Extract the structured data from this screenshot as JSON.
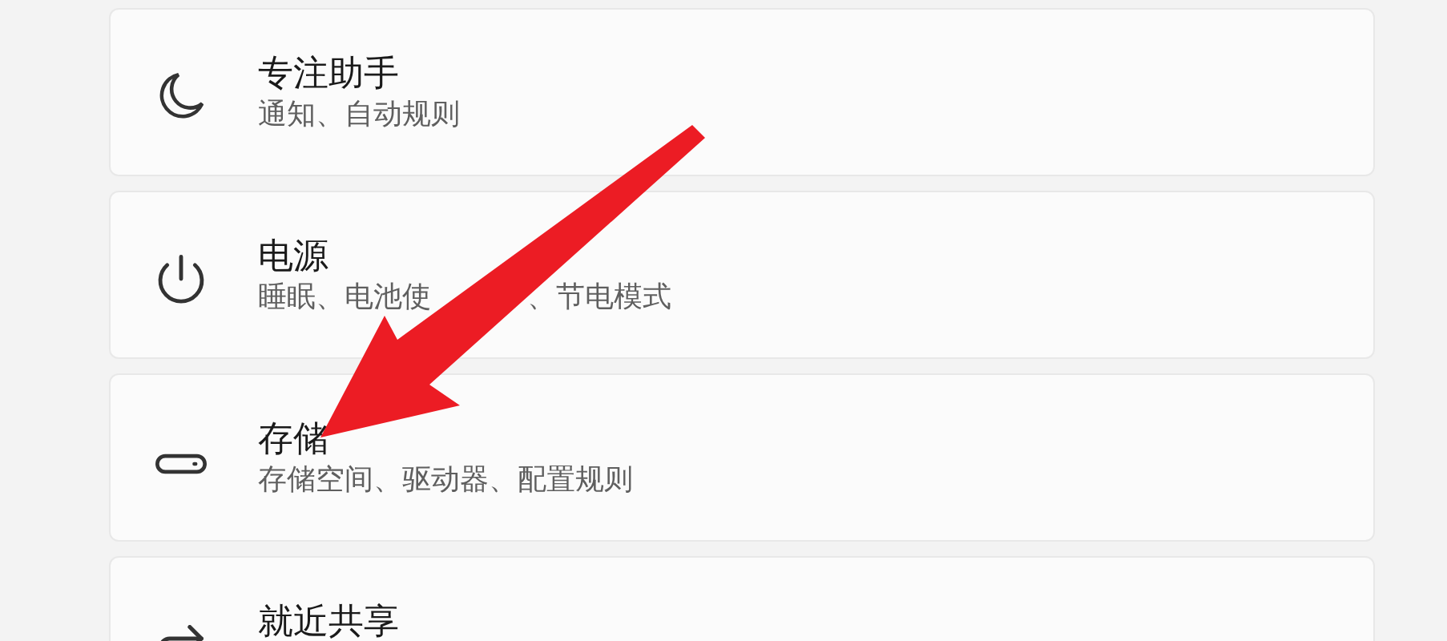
{
  "settings_items": [
    {
      "kind": "focus",
      "title": "专注助手",
      "subtitle": [
        "通知、自动规则"
      ]
    },
    {
      "kind": "power",
      "title": "电源",
      "subtitle": [
        "睡眠、电池使",
        "、节电模式"
      ]
    },
    {
      "kind": "storage",
      "title": "存储",
      "subtitle": [
        "存储空间、驱动器、配置规则"
      ]
    },
    {
      "kind": "share",
      "title": "就近共享"
    }
  ]
}
